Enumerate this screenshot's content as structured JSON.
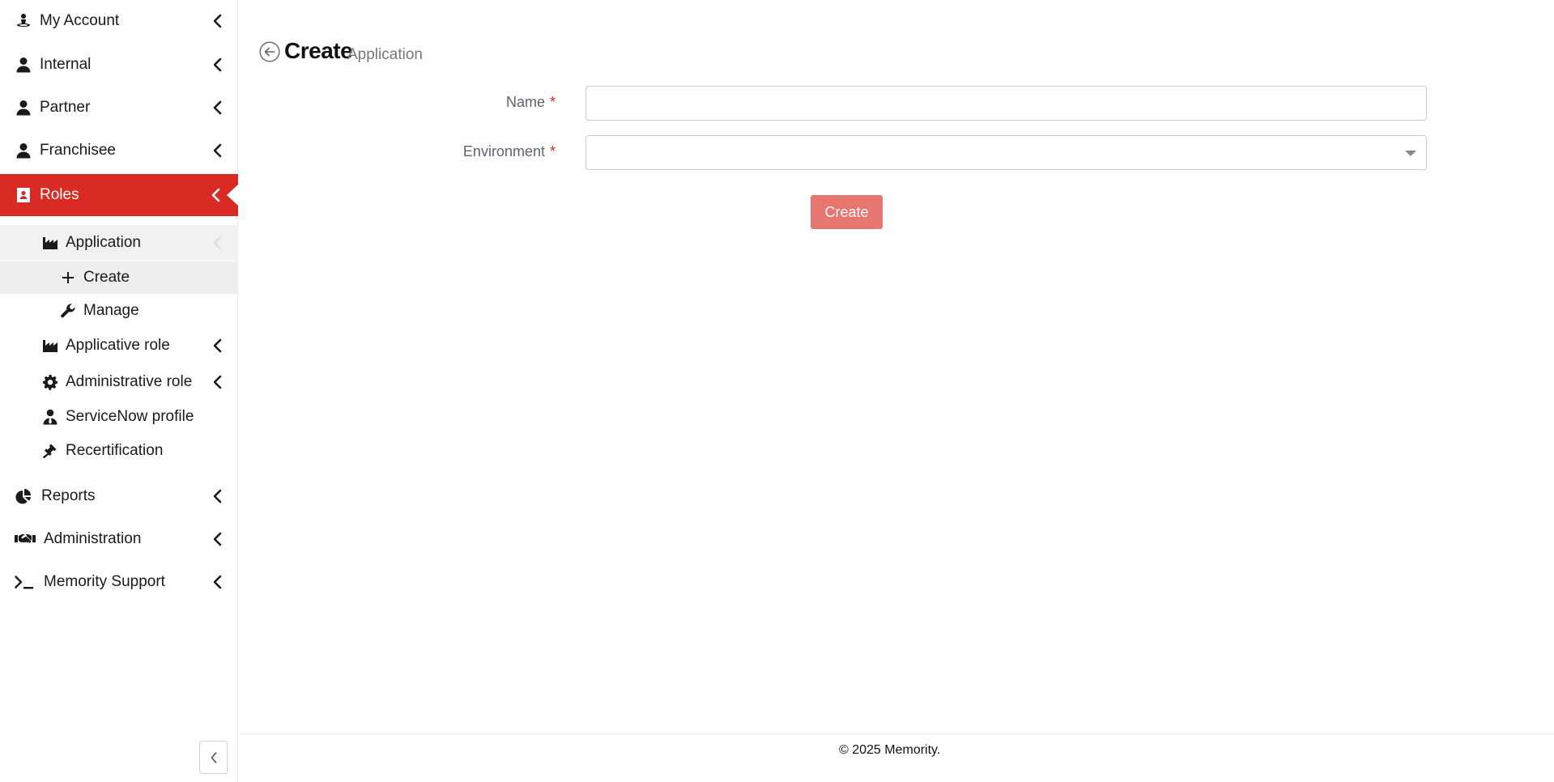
{
  "sidebar": {
    "items": [
      {
        "label": "My Account",
        "icon": "user-map-icon"
      },
      {
        "label": "Internal",
        "icon": "user-icon"
      },
      {
        "label": "Partner",
        "icon": "user-icon"
      },
      {
        "label": "Franchisee",
        "icon": "user-icon"
      },
      {
        "label": "Roles",
        "icon": "id-badge-icon",
        "active": true
      },
      {
        "label": "Reports",
        "icon": "pie-chart-icon"
      },
      {
        "label": "Administration",
        "icon": "handshake-icon"
      },
      {
        "label": "Memority Support",
        "icon": "terminal-icon"
      }
    ],
    "roles_children": [
      {
        "label": "Application",
        "icon": "industry-icon"
      },
      {
        "label": "Applicative role",
        "icon": "industry-icon"
      },
      {
        "label": "Administrative role",
        "icon": "gear-icon"
      },
      {
        "label": "ServiceNow profile",
        "icon": "user-tie-icon"
      },
      {
        "label": "Recertification",
        "icon": "gavel-icon"
      }
    ],
    "application_children": [
      {
        "label": "Create",
        "icon": "plus-icon",
        "selected": true
      },
      {
        "label": "Manage",
        "icon": "wrench-icon"
      }
    ]
  },
  "page": {
    "title": "Create",
    "subtitle": "Application"
  },
  "form": {
    "name_label": "Name",
    "name_value": "",
    "environment_label": "Environment",
    "environment_value": "",
    "required_mark": "*",
    "submit_label": "Create"
  },
  "footer": {
    "text": "© 2025 Memority."
  },
  "colors": {
    "accent": "#d92b23",
    "button_disabled": "#e87670"
  }
}
